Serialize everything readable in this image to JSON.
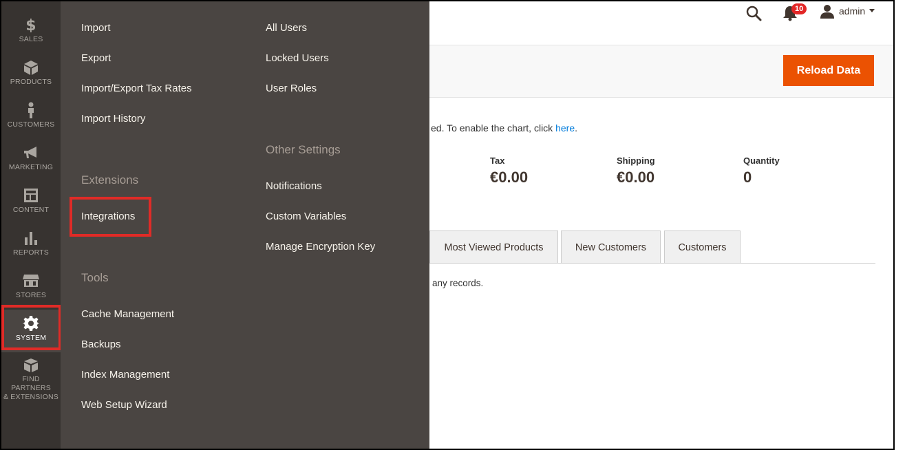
{
  "sidebar": {
    "items": [
      {
        "label": "SALES",
        "icon": "dollar-icon"
      },
      {
        "label": "PRODUCTS",
        "icon": "cube-icon"
      },
      {
        "label": "CUSTOMERS",
        "icon": "person-icon"
      },
      {
        "label": "MARKETING",
        "icon": "megaphone-icon"
      },
      {
        "label": "CONTENT",
        "icon": "layout-icon"
      },
      {
        "label": "REPORTS",
        "icon": "bar-chart-icon"
      },
      {
        "label": "STORES",
        "icon": "store-icon"
      },
      {
        "label": "SYSTEM",
        "icon": "gear-icon"
      },
      {
        "label_line1": "FIND PARTNERS",
        "label_line2": "& EXTENSIONS",
        "icon": "blocks-icon"
      }
    ]
  },
  "flyout": {
    "col1": {
      "items_top": [
        "Import",
        "Export",
        "Import/Export Tax Rates",
        "Import History"
      ],
      "extensions_heading": "Extensions",
      "extensions_items": [
        "Integrations"
      ],
      "tools_heading": "Tools",
      "tools_items": [
        "Cache Management",
        "Backups",
        "Index Management",
        "Web Setup Wizard"
      ]
    },
    "col2": {
      "items_top": [
        "All Users",
        "Locked Users",
        "User Roles"
      ],
      "other_heading": "Other Settings",
      "other_items": [
        "Notifications",
        "Custom Variables",
        "Manage Encryption Key"
      ]
    }
  },
  "header": {
    "notification_count": "10",
    "user_name": "admin"
  },
  "page": {
    "reload_label": "Reload Data",
    "notice_text": "ed. To enable the chart, click ",
    "notice_link": "here",
    "notice_end": ".",
    "stats": [
      {
        "label": "Tax",
        "value": "€0.00"
      },
      {
        "label": "Shipping",
        "value": "€0.00"
      },
      {
        "label": "Quantity",
        "value": "0"
      }
    ],
    "tabs": [
      "Most Viewed Products",
      "New Customers",
      "Customers"
    ],
    "records_text": "any records."
  },
  "colors": {
    "sidebar_bg": "#373330",
    "flyout_bg": "#4a4542",
    "accent": "#eb5202",
    "highlight": "#e02b27"
  }
}
